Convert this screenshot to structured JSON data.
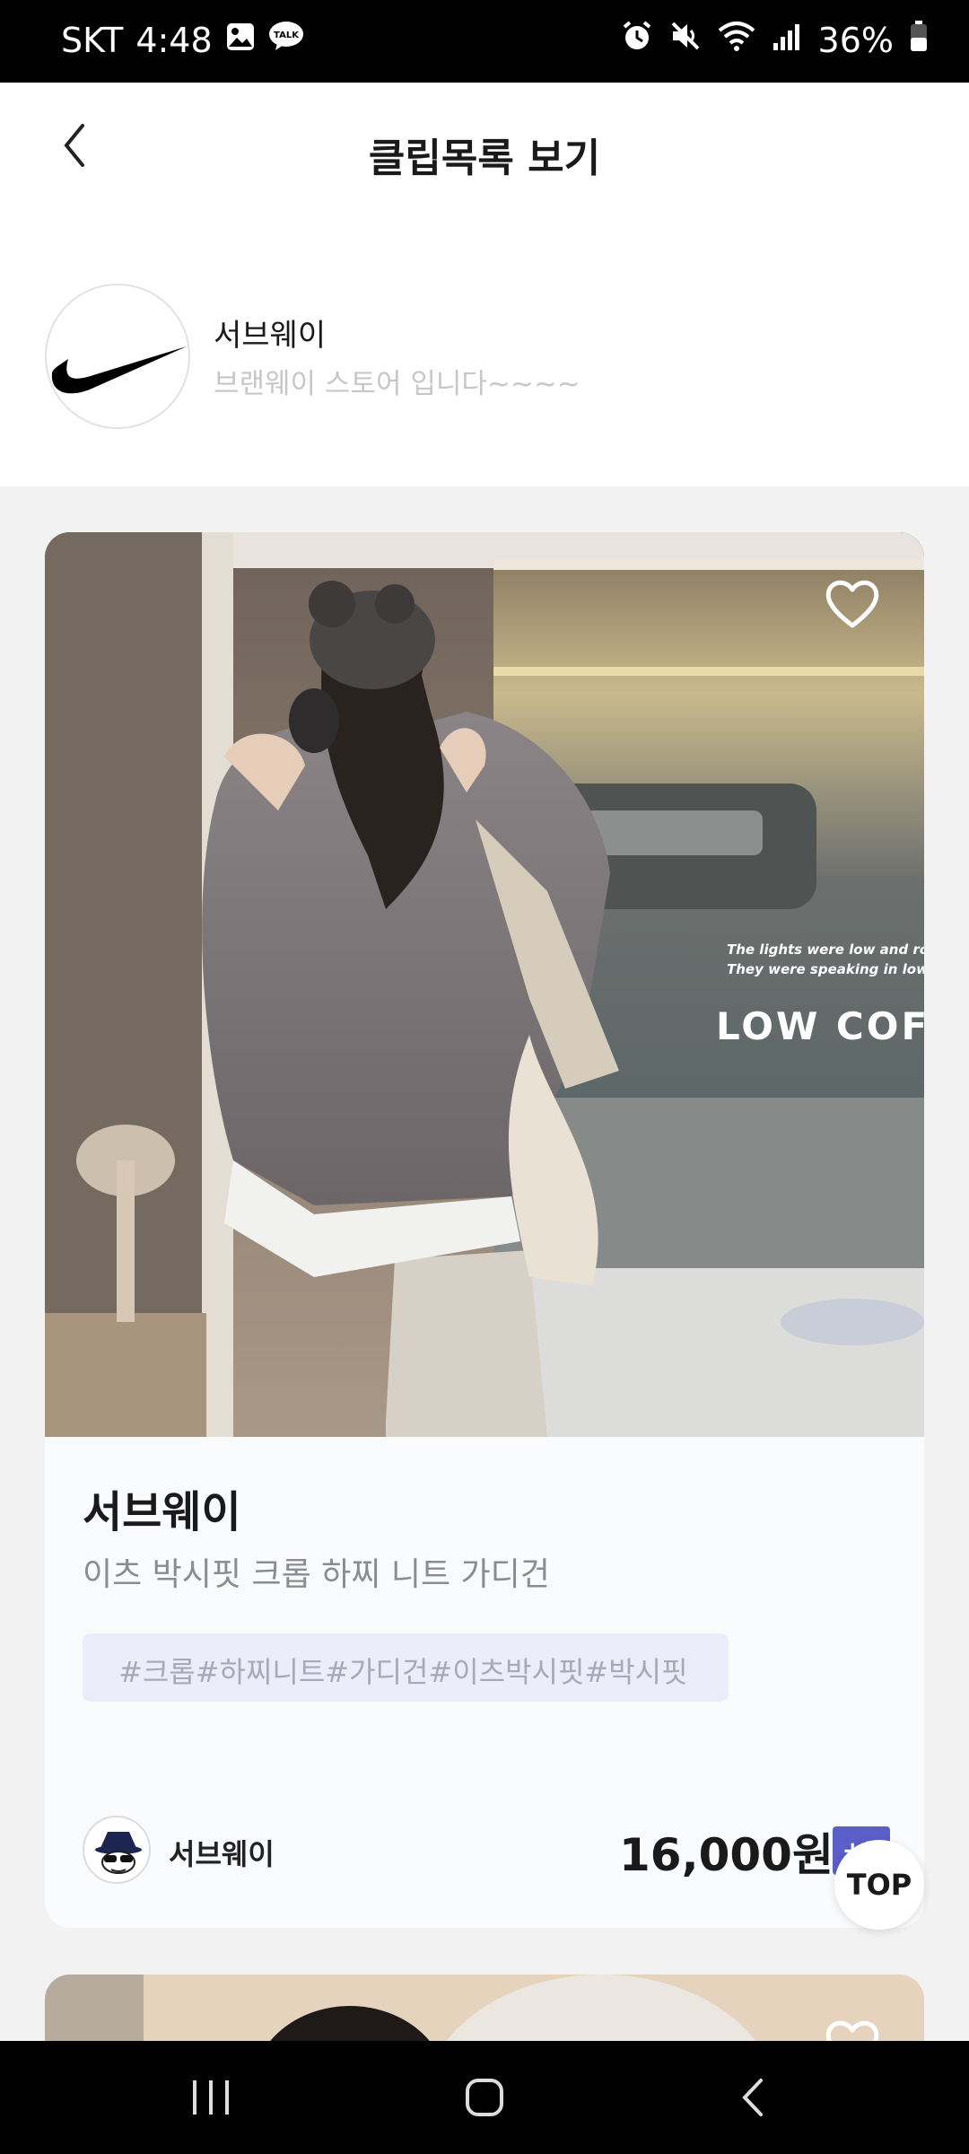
{
  "status_bar": {
    "carrier": "SKT",
    "time": "4:48",
    "battery": "36%",
    "icons": [
      "gallery-icon",
      "talk-icon",
      "alarm-icon",
      "mute-icon",
      "wifi-icon",
      "signal-icon",
      "battery-icon"
    ],
    "talk_label": "TALK"
  },
  "header": {
    "title": "클립목록 보기",
    "back_icon": "back-chevron-icon"
  },
  "brand": {
    "name": "서브웨이",
    "description": "브랜웨이 스토어 입니다~~~~",
    "logo_icon": "swoosh-logo"
  },
  "card": {
    "image_caption_lines": [
      "The lights were low and roma",
      "They were speaking in low voi"
    ],
    "image_sign_text": "LOW COFF",
    "brand": "서브웨이",
    "product_name": "이츠 박시핏 크롭 하찌 니트 가디건",
    "tags": "#크롭#하찌니트#가디건#이츠박시핏#박시핏",
    "seller_name": "서브웨이",
    "price": "16,000원",
    "plus_badge": "+1",
    "favorite_icon": "heart-outline-icon"
  },
  "floating": {
    "top_label": "TOP"
  },
  "nav": {
    "icons": [
      "recent-apps-icon",
      "home-icon",
      "back-icon"
    ]
  },
  "colors": {
    "accent": "#5b5fc7",
    "tag_bg": "#ecedfa",
    "page_bg": "#f2f2f3"
  }
}
